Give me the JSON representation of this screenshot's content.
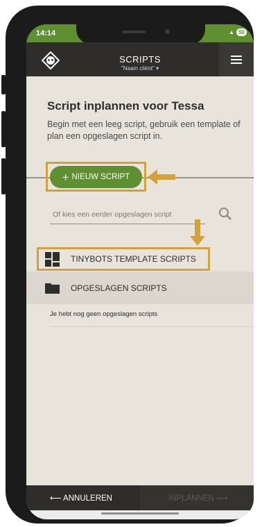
{
  "status_bar": {
    "time": "14:14",
    "battery": "50"
  },
  "header": {
    "title": "SCRIPTS",
    "client_selector": "\"Naam cliënt\""
  },
  "page": {
    "title": "Script inplannen voor Tessa",
    "intro": "Begin met een leeg script, gebruik een template of plan een opgeslagen script in."
  },
  "new_script": {
    "label": "NIEUW SCRIPT"
  },
  "search": {
    "placeholder": "Of kies een eerder opgeslagen script"
  },
  "lists": {
    "template_label": "TINYBOTS TEMPLATE SCRIPTS",
    "saved_label": "OPGESLAGEN SCRIPTS",
    "empty_message": "Je hebt nog geen opgeslagen scripts"
  },
  "footer": {
    "cancel_label": "ANNULEREN",
    "plan_label": "INPLANNEN"
  },
  "colors": {
    "accent_green": "#5e8f31",
    "highlight": "#d4a23c",
    "dark": "#2e2d2b",
    "background": "#e8e4dc"
  },
  "icons": [
    "robot-logo-icon",
    "hamburger-menu-icon",
    "plus-icon",
    "search-icon",
    "template-grid-icon",
    "folder-icon",
    "arrow-left-icon",
    "arrow-right-icon"
  ]
}
